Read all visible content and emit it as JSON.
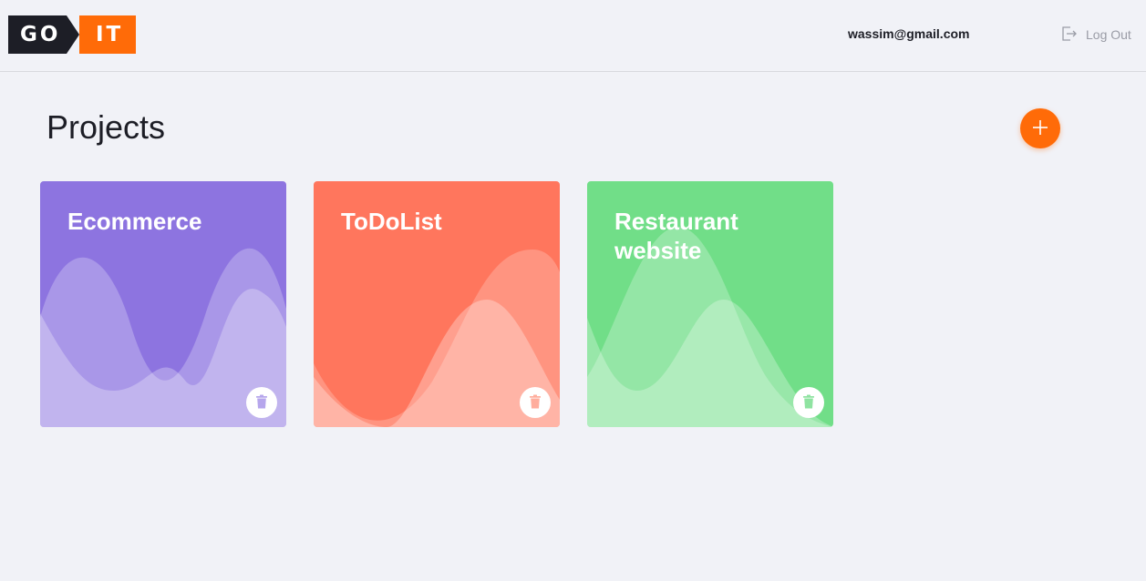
{
  "header": {
    "logo": {
      "left_text": "GO",
      "right_text": "IT"
    },
    "user_email": "wassim@gmail.com",
    "logout_label": "Log Out"
  },
  "main": {
    "title": "Projects",
    "add_icon": "plus-icon",
    "projects": [
      {
        "title": "Ecommerce",
        "color": "#8d74e0",
        "delete_icon": "trash-icon"
      },
      {
        "title": "ToDoList",
        "color": "#ff765d",
        "delete_icon": "trash-icon"
      },
      {
        "title": "Restaurant website",
        "color": "#71de88",
        "delete_icon": "trash-icon"
      }
    ]
  },
  "colors": {
    "accent": "#ff6b08",
    "logo_dark": "#1d1e26",
    "background": "#f1f2f7"
  }
}
